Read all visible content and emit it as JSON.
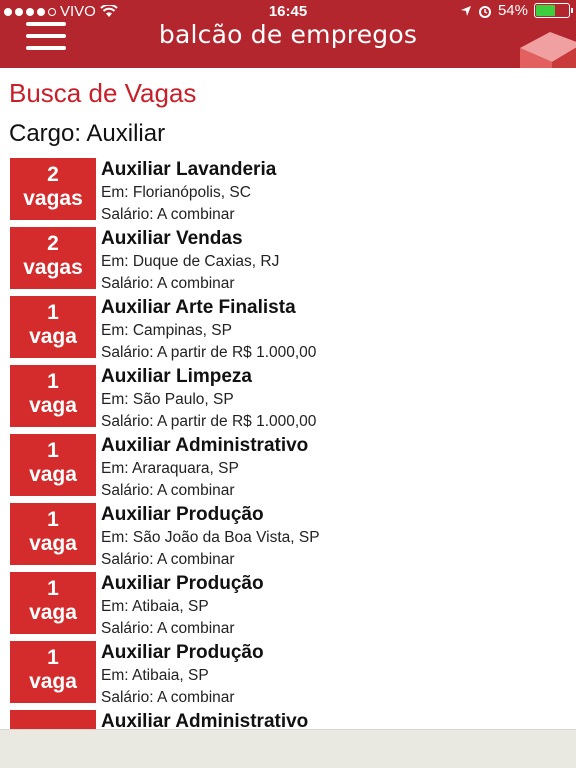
{
  "status_bar": {
    "carrier": "VIVO",
    "time": "16:45",
    "battery": "54%"
  },
  "header": {
    "logo": "balcão de empregos"
  },
  "page": {
    "title": "Busca de Vagas",
    "cargo": "Cargo: Auxiliar"
  },
  "jobs": [
    {
      "count": "2",
      "unit": "vagas",
      "title": "Auxiliar Lavanderia",
      "location": "Em: Florianópolis, SC",
      "salary": "Salário: A combinar"
    },
    {
      "count": "2",
      "unit": "vagas",
      "title": "Auxiliar Vendas",
      "location": "Em: Duque de Caxias, RJ",
      "salary": "Salário: A combinar"
    },
    {
      "count": "1",
      "unit": "vaga",
      "title": "Auxiliar Arte Finalista",
      "location": "Em: Campinas, SP",
      "salary": "Salário: A partir de R$ 1.000,00"
    },
    {
      "count": "1",
      "unit": "vaga",
      "title": "Auxiliar Limpeza",
      "location": "Em: São Paulo, SP",
      "salary": "Salário: A partir de R$ 1.000,00"
    },
    {
      "count": "1",
      "unit": "vaga",
      "title": "Auxiliar Administrativo",
      "location": "Em: Araraquara, SP",
      "salary": "Salário: A combinar"
    },
    {
      "count": "1",
      "unit": "vaga",
      "title": "Auxiliar Produção",
      "location": "Em: São João da Boa Vista, SP",
      "salary": "Salário: A combinar"
    },
    {
      "count": "1",
      "unit": "vaga",
      "title": "Auxiliar Produção",
      "location": "Em: Atibaia, SP",
      "salary": "Salário: A combinar"
    },
    {
      "count": "1",
      "unit": "vaga",
      "title": "Auxiliar Produção",
      "location": "Em: Atibaia, SP",
      "salary": "Salário: A combinar"
    },
    {
      "count": "",
      "unit": "",
      "title": "Auxiliar Administrativo",
      "location": "",
      "salary": ""
    }
  ],
  "icons": {
    "menu": "hamburger-menu-icon",
    "wifi": "wifi-icon",
    "location": "location-arrow-icon",
    "alarm": "alarm-clock-icon",
    "battery": "battery-icon",
    "logo_graphic": "cube-logo-icon"
  },
  "colors": {
    "header": "#b3262e",
    "badge": "#d42c2c",
    "title_red": "#c8202a",
    "bottom_bar": "#e9e9e1"
  }
}
